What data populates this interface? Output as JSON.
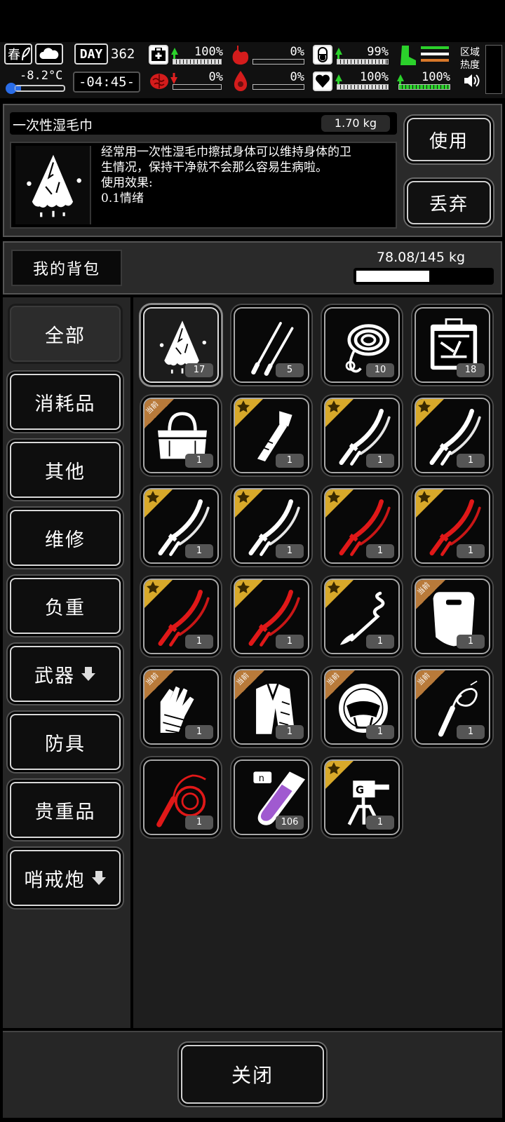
{
  "hud": {
    "season": "春",
    "temperature": "-8.2°C",
    "day_label": "DAY",
    "day_number": "362",
    "time": "-04:45-",
    "region_heat_label": "区域\n热度",
    "stats": [
      {
        "name": "health",
        "value": "100%",
        "level": 1.0,
        "trend": "up"
      },
      {
        "name": "stomach",
        "value": "0%",
        "level": 0.0,
        "trend": "none"
      },
      {
        "name": "capsule",
        "value": "99%",
        "level": 0.99,
        "trend": "up"
      },
      {
        "name": "brain",
        "value": "0%",
        "level": 0.0,
        "trend": "down"
      },
      {
        "name": "blood",
        "value": "0%",
        "level": 0.0,
        "trend": "none"
      },
      {
        "name": "heart",
        "value": "100%",
        "level": 1.0,
        "trend": "up"
      },
      {
        "name": "stamina",
        "value": "100%",
        "level": 1.0,
        "trend": "up"
      }
    ],
    "colors": {
      "up": "#2bd12b",
      "down": "#e02020",
      "stamina": "#2bd12b"
    }
  },
  "item_detail": {
    "name": "一次性湿毛巾",
    "weight": "1.70 kg",
    "description_lines": [
      "经常用一次性湿毛巾擦拭身体可以维持身体的卫",
      "生情况，保持干净就不会那么容易生病啦。",
      "使用效果:",
      "0.1情绪"
    ],
    "use_button": "使用",
    "discard_button": "丢弃"
  },
  "backpack": {
    "title": "我的背包",
    "capacity": "78.08/145 kg",
    "fill_fraction": 0.54
  },
  "categories": [
    {
      "label": "全部",
      "selected": true
    },
    {
      "label": "消耗品",
      "selected": false
    },
    {
      "label": "其他",
      "selected": false
    },
    {
      "label": "维修",
      "selected": false
    },
    {
      "label": "负重",
      "selected": false
    },
    {
      "label": "武器",
      "selected": false,
      "arrow": true
    },
    {
      "label": "防具",
      "selected": false
    },
    {
      "label": "贵重品",
      "selected": false
    },
    {
      "label": "哨戒炮",
      "selected": false,
      "arrow": true
    }
  ],
  "tag_labels": {
    "equipped": "当前"
  },
  "items": [
    {
      "icon": "wet-towel",
      "count": "17",
      "tag": "",
      "selected": true
    },
    {
      "icon": "chopsticks",
      "count": "5",
      "tag": ""
    },
    {
      "icon": "rope",
      "count": "10",
      "tag": ""
    },
    {
      "icon": "toolbox",
      "count": "18",
      "tag": ""
    },
    {
      "icon": "bag",
      "count": "1",
      "tag": "equipped"
    },
    {
      "icon": "axe-knife",
      "count": "1",
      "tag": "star"
    },
    {
      "icon": "katana-white",
      "count": "1",
      "tag": "star"
    },
    {
      "icon": "katana-white",
      "count": "1",
      "tag": "star"
    },
    {
      "icon": "katana-white",
      "count": "1",
      "tag": "star"
    },
    {
      "icon": "katana-white",
      "count": "1",
      "tag": "star"
    },
    {
      "icon": "katana-red",
      "count": "1",
      "tag": "star"
    },
    {
      "icon": "katana-red",
      "count": "1",
      "tag": "star"
    },
    {
      "icon": "katana-red",
      "count": "1",
      "tag": "star"
    },
    {
      "icon": "katana-red",
      "count": "1",
      "tag": "star"
    },
    {
      "icon": "whip-staff",
      "count": "1",
      "tag": "star"
    },
    {
      "icon": "riot-shield",
      "count": "1",
      "tag": "equipped"
    },
    {
      "icon": "chain-gloves",
      "count": "1",
      "tag": "equipped"
    },
    {
      "icon": "armor-coat",
      "count": "1",
      "tag": "equipped"
    },
    {
      "icon": "helmet",
      "count": "1",
      "tag": "equipped"
    },
    {
      "icon": "whip-white",
      "count": "1",
      "tag": "equipped"
    },
    {
      "icon": "whip-red",
      "count": "1",
      "tag": ""
    },
    {
      "icon": "test-tube",
      "count": "106",
      "tag": ""
    },
    {
      "icon": "sentry-turret",
      "count": "1",
      "tag": "star"
    }
  ],
  "close_button": "关闭",
  "colors": {
    "tag_gold": "#d8a92a",
    "tag_bronze": "#b87a3a",
    "red_blade": "#e01818",
    "purple_liquid": "#a05ad0"
  }
}
